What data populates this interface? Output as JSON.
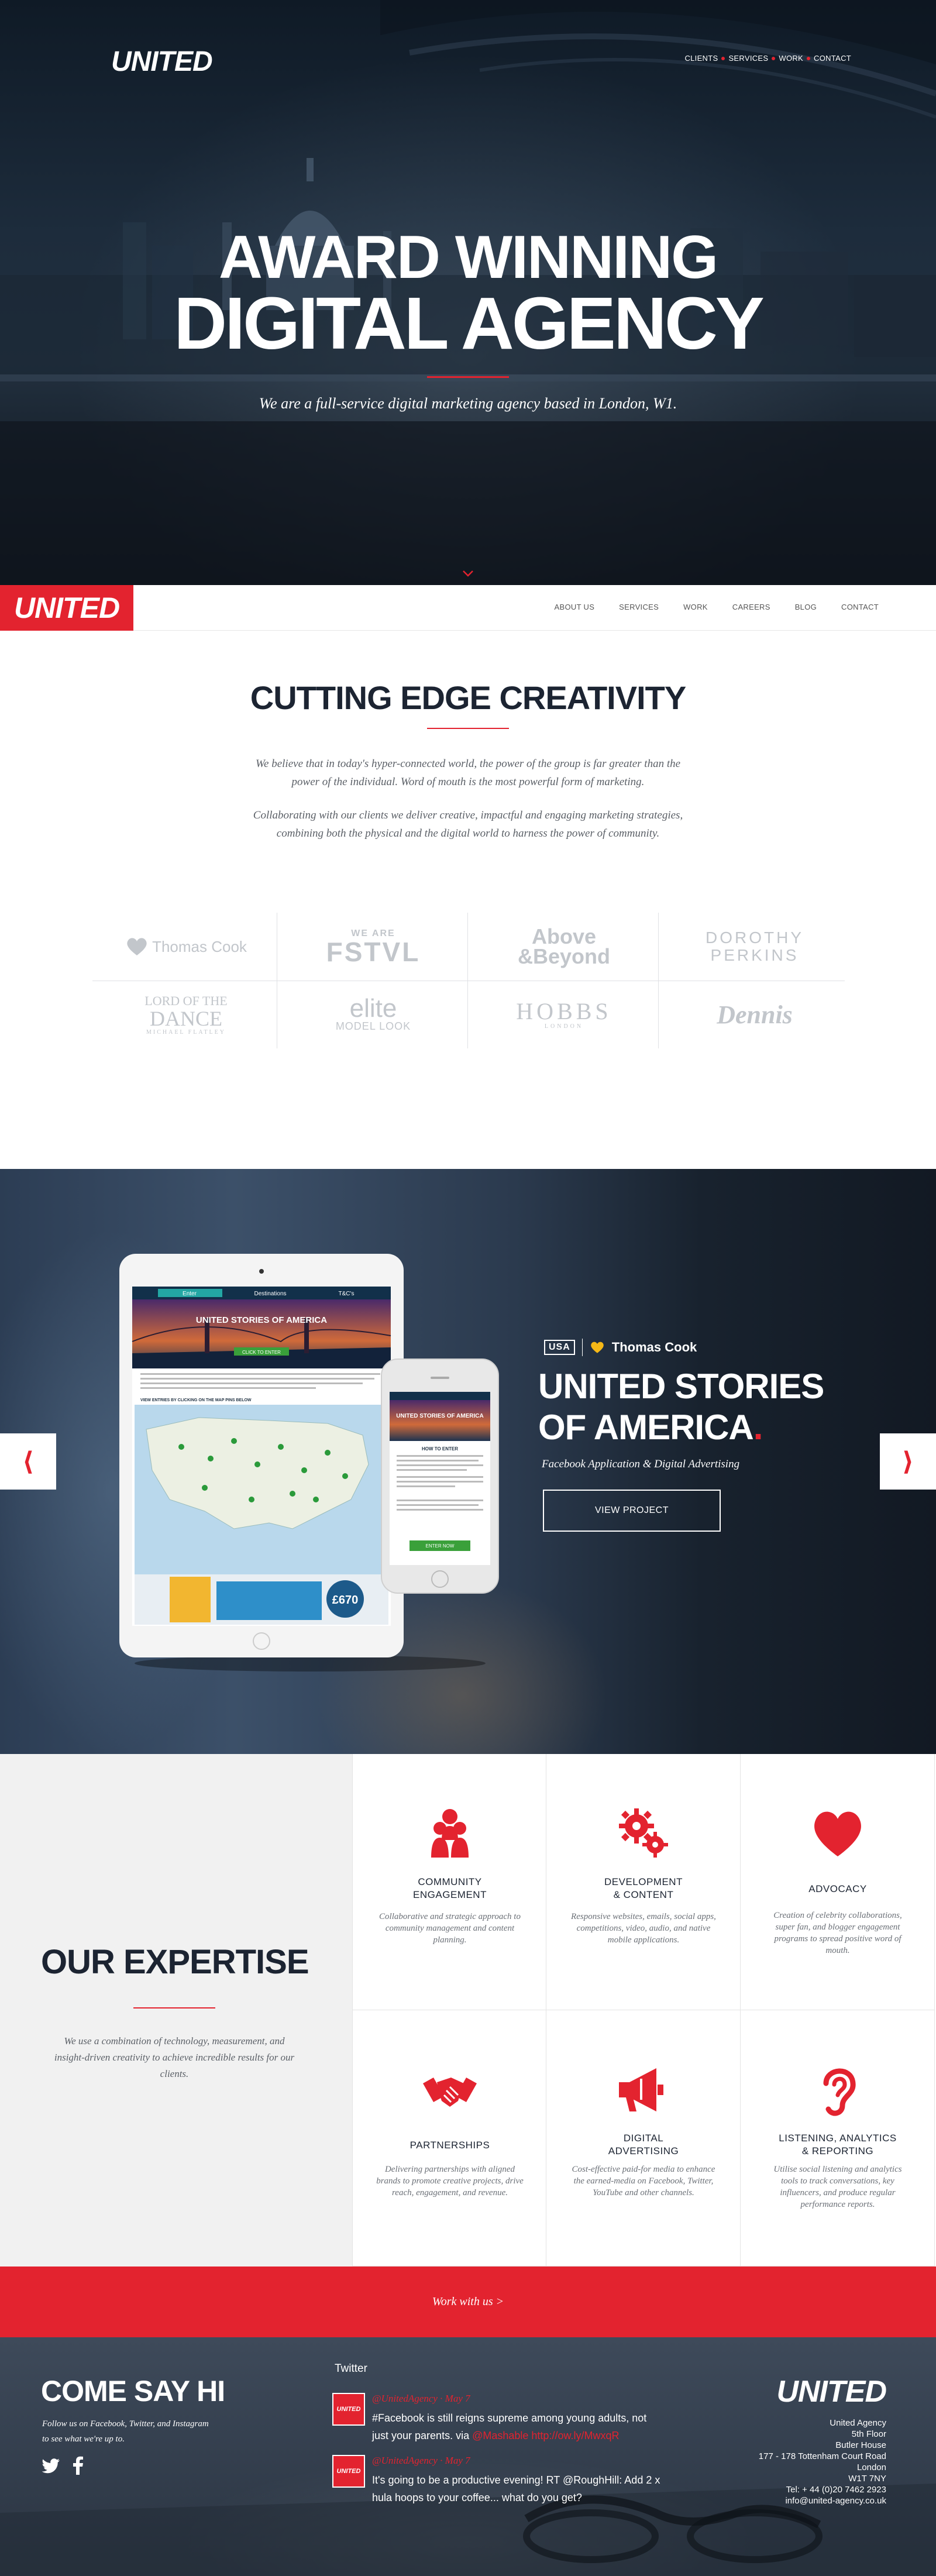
{
  "hero": {
    "logo": "UNITED",
    "nav": [
      "CLIENTS",
      "SERVICES",
      "WORK",
      "CONTACT"
    ],
    "title_line1": "AWARD WINNING",
    "title_line2": "DIGITAL AGENCY",
    "subtitle": "We are a full-service digital marketing agency based in London, W1."
  },
  "navbar": {
    "logo": "UNITED",
    "links": [
      "ABOUT US",
      "SERVICES",
      "WORK",
      "CAREERS",
      "BLOG",
      "CONTACT"
    ]
  },
  "creativity": {
    "title": "CUTTING EDGE CREATIVITY",
    "paragraph1_line1": "We believe that in today's hyper-connected world, the power of the group is far greater than the",
    "paragraph1_line2": "power of the individual. Word of mouth is the most powerful form of marketing.",
    "paragraph2_line1": "Collaborating with our clients we deliver creative, impactful and engaging marketing strategies,",
    "paragraph2_line2": "combining both the physical and the digital world to harness the power of community.",
    "clients": [
      {
        "name": "Thomas Cook"
      },
      {
        "name_top": "WE ARE",
        "name": "FSTVL"
      },
      {
        "name": "Above",
        "name2": "&Beyond"
      },
      {
        "name": "DOROTHY",
        "name2": "PERKINS"
      },
      {
        "name": "LORD OF THE",
        "name2": "DANCE",
        "name3": "MICHAEL FLATLEY"
      },
      {
        "name": "elite",
        "name2": "MODEL LOOK"
      },
      {
        "name": "HOBBS",
        "name2": "LONDON"
      },
      {
        "name": "Dennis"
      }
    ]
  },
  "case_study": {
    "prev_icon": "chevron-left-icon",
    "next_icon": "chevron-right-icon",
    "brand_usa": "USA",
    "brand_name": "Thomas Cook",
    "title_line1": "UNITED STORIES",
    "title_line2": "OF AMERICA",
    "title_dot": ".",
    "subtitle": "Facebook Application & Digital Advertising",
    "button": "VIEW PROJECT",
    "mockup": {
      "tabs": [
        "Enter",
        "Destinations",
        "T&C's"
      ],
      "headline": "UNITED STORIES OF AMERICA",
      "cta": "CLICK TO ENTER",
      "map_caption": "VIEW ENTRIES BY CLICKING ON THE MAP PINS BELOW",
      "price": "£670",
      "phone_heading": "HOW TO ENTER",
      "phone_button": "ENTER NOW"
    }
  },
  "expertise": {
    "title": "OUR EXPERTISE",
    "description": "We use a combination of technology, measurement, and insight-driven creativity to achieve incredible results for our clients.",
    "items": [
      {
        "icon": "community-icon",
        "title_l1": "COMMUNITY",
        "title_l2": "ENGAGEMENT",
        "desc": "Collaborative and strategic approach to community management and content planning."
      },
      {
        "icon": "gears-icon",
        "title_l1": "DEVELOPMENT",
        "title_l2": "& CONTENT",
        "desc": "Responsive websites, emails, social apps, competitions, video, audio, and native mobile applications."
      },
      {
        "icon": "heart-icon",
        "title_l1": "ADVOCACY",
        "title_l2": "",
        "desc": "Creation of celebrity collaborations, super fan, and blogger engagement programs to spread positive word of mouth."
      },
      {
        "icon": "handshake-icon",
        "title_l1": "PARTNERSHIPS",
        "title_l2": "",
        "desc": "Delivering partnerships with aligned brands to promote creative projects, drive reach, engagement, and revenue."
      },
      {
        "icon": "megaphone-icon",
        "title_l1": "DIGITAL",
        "title_l2": "ADVERTISING",
        "desc": "Cost-effective paid-for media to enhance the earned-media on Facebook, Twitter, YouTube and other channels."
      },
      {
        "icon": "ear-icon",
        "title_l1": "LISTENING, ANALYTICS",
        "title_l2": "& REPORTING",
        "desc": "Utilise social listening and analytics tools to track conversations, key influencers, and produce regular performance reports."
      }
    ]
  },
  "cta": {
    "label": "Work with us >"
  },
  "footer": {
    "hi_title": "COME SAY HI",
    "hi_text_l1": "Follow us on Facebook, Twitter, and Instagram",
    "hi_text_l2": "to see what we're up to.",
    "social": [
      "twitter-icon",
      "facebook-icon"
    ],
    "twitter_heading": "Twitter",
    "tweets": [
      {
        "avatar": "UNITED",
        "handle": "@UnitedAgency · May 7",
        "text_l1": "#Facebook is still reigns supreme among young adults, not",
        "text_l2": "just your parents. via",
        "link": "@Mashable http://ow.ly/MwxqR"
      },
      {
        "avatar": "UNITED",
        "handle": "@UnitedAgency · May 7",
        "text_l1": "It's going to be a productive evening! RT @RoughHill: Add 2 x",
        "text_l2": "hula hoops to your coffee... what do you get?",
        "link": ""
      }
    ],
    "logo": "UNITED",
    "address": [
      "United Agency",
      "5th Floor",
      "Butler House",
      "177 - 178 Tottenham Court Road",
      "London",
      "W1T 7NY",
      "Tel: + 44 (0)20 7462 2923",
      "info@united-agency.co.uk"
    ]
  },
  "colors": {
    "accent": "#e3232f",
    "navy": "#1c2432",
    "light_bg": "#f1f1f1"
  }
}
